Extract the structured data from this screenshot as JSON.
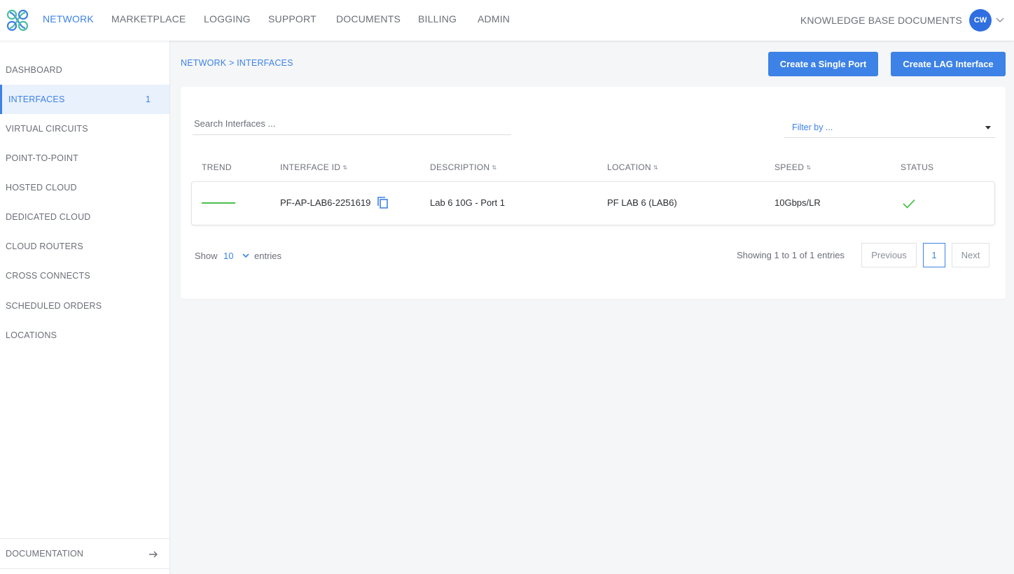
{
  "nav": {
    "items": [
      "NETWORK",
      "MARKETPLACE",
      "LOGGING",
      "SUPPORT",
      "DOCUMENTS",
      "BILLING",
      "ADMIN"
    ],
    "active": "NETWORK",
    "right_link": "KNOWLEDGE BASE DOCUMENTS",
    "avatar_initials": "CW"
  },
  "sidebar": {
    "items": [
      {
        "label": "DASHBOARD"
      },
      {
        "label": "INTERFACES",
        "count": "1",
        "active": true
      },
      {
        "label": "VIRTUAL CIRCUITS"
      },
      {
        "label": "POINT-TO-POINT"
      },
      {
        "label": "HOSTED CLOUD"
      },
      {
        "label": "DEDICATED CLOUD"
      },
      {
        "label": "CLOUD ROUTERS"
      },
      {
        "label": "CROSS CONNECTS"
      },
      {
        "label": "SCHEDULED ORDERS"
      },
      {
        "label": "LOCATIONS"
      }
    ],
    "footer": "DOCUMENTATION"
  },
  "breadcrumb": "NETWORK > INTERFACES",
  "actions": {
    "single_port": "Create a Single Port",
    "lag_interface": "Create LAG Interface"
  },
  "table": {
    "search_placeholder": "Search Interfaces ...",
    "filter_placeholder": "Filter by ...",
    "headers": [
      "TREND",
      "INTERFACE ID",
      "DESCRIPTION",
      "LOCATION",
      "SPEED",
      "STATUS"
    ],
    "rows": [
      {
        "interface_id": "PF-AP-LAB6-2251619",
        "description": "Lab 6 10G - Port 1",
        "location": "PF LAB 6 (LAB6)",
        "speed": "10Gbps/LR",
        "status": "ok"
      }
    ]
  },
  "pagination": {
    "show_label": "Show",
    "page_size": "10",
    "entries_label": "entries",
    "summary": "Showing 1 to 1 of 1 entries",
    "previous": "Previous",
    "current_page": "1",
    "next": "Next"
  },
  "colors": {
    "accent": "#3d82e6",
    "trend": "#4cc04c",
    "status_ok": "#4cc04c"
  }
}
